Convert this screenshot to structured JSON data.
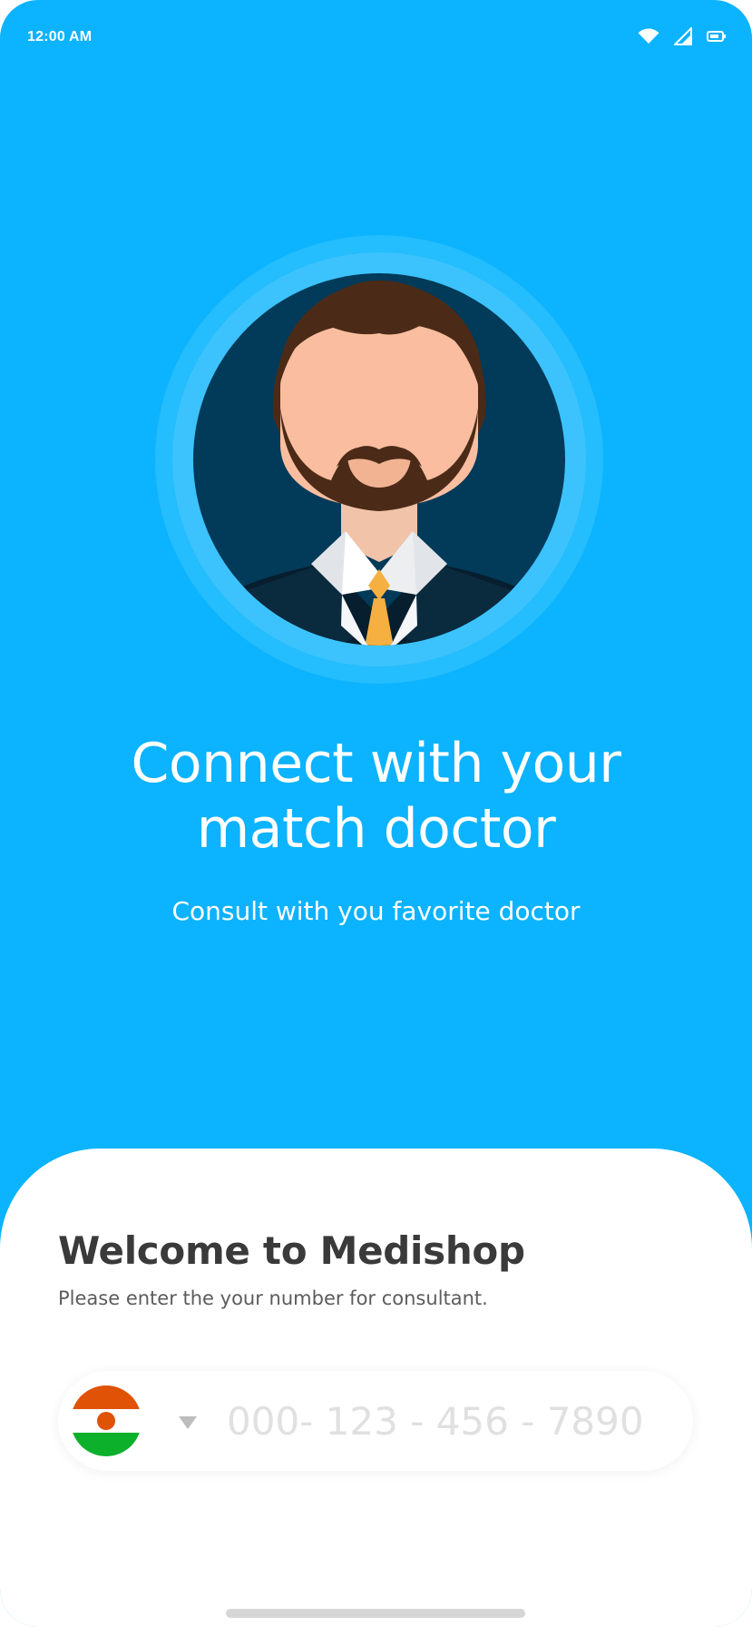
{
  "status_bar": {
    "time": "12:00 AM",
    "icons": [
      "wifi-icon",
      "cellular-signal-icon",
      "battery-icon"
    ]
  },
  "hero": {
    "avatar": "doctor-avatar-illustration",
    "title_line1": "Connect with your",
    "title_line2": "match doctor",
    "subtitle": "Consult with you favorite doctor"
  },
  "welcome": {
    "title": "Welcome to Medishop",
    "description": "Please enter the your number for consultant."
  },
  "phone": {
    "country_flag": "niger-flag",
    "dropdown_icon": "caret-down-icon",
    "placeholder": "000- 123 - 456 - 7890",
    "value": ""
  },
  "colors": {
    "primary": "#0cb3fe",
    "avatar_bg": "#023a59",
    "text_dark": "#3a3a3a",
    "text_muted": "#5c5c5c",
    "placeholder": "#e0e0e0",
    "flag_orange": "#e05206",
    "flag_green": "#0db02b"
  }
}
